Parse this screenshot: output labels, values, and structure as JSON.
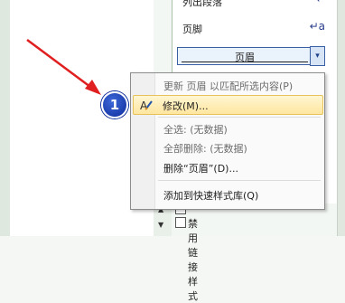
{
  "styles_pane": {
    "items": [
      {
        "label": "列出段落",
        "mark": "↵"
      },
      {
        "label": "页脚",
        "mark": "↵a"
      },
      {
        "label": "页眉",
        "mark": "▾"
      }
    ],
    "bottom_rows": [
      {
        "label": ""
      },
      {
        "label": "禁用链接样式"
      }
    ]
  },
  "context_menu": {
    "items": [
      {
        "label": "更新 页眉 以匹配所选内容(P)",
        "disabled": true
      },
      {
        "label": "修改(M)...",
        "highlighted": true,
        "icon": "modify-style-icon"
      },
      {
        "label": "全选: (无数据)",
        "disabled": true
      },
      {
        "label": "全部删除: (无数据)",
        "disabled": true
      },
      {
        "label": "删除“页眉”(D)...",
        "disabled": false
      },
      {
        "label": "添加到快速样式库(Q)",
        "disabled": false
      }
    ]
  },
  "annotation": {
    "number": "1",
    "arrow_color": "#e02020",
    "badge_color": "#1a3bb5"
  },
  "colors": {
    "highlight": "#ffe6a0",
    "selection_border": "#3b5fa5"
  }
}
